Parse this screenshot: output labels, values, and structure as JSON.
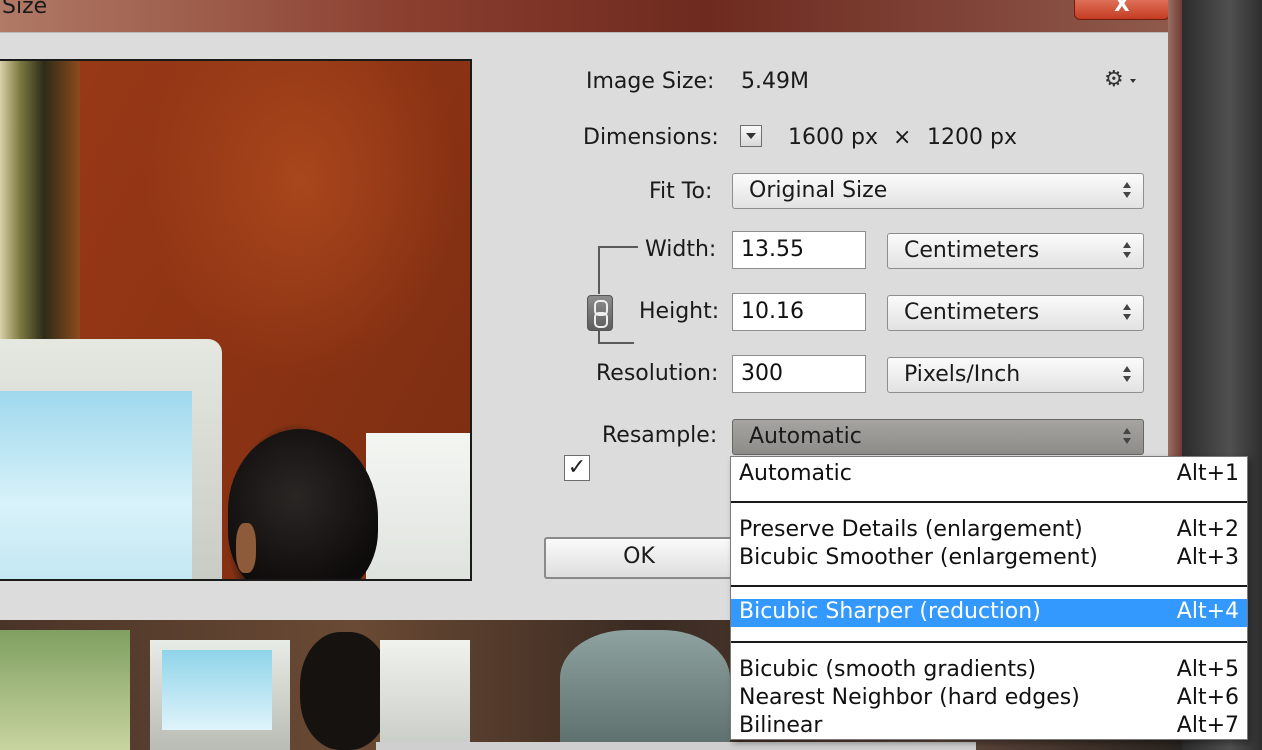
{
  "window": {
    "title": "Size",
    "close_label": "X"
  },
  "form": {
    "image_size_label": "Image Size:",
    "image_size_value": "5.49M",
    "dimensions_label": "Dimensions:",
    "dimensions_width": "1600 px",
    "dimensions_times": "×",
    "dimensions_height": "1200 px",
    "fit_to_label": "Fit To:",
    "fit_to_value": "Original Size",
    "width_label": "Width:",
    "width_value": "13.55",
    "width_unit": "Centimeters",
    "height_label": "Height:",
    "height_value": "10.16",
    "height_unit": "Centimeters",
    "resolution_label": "Resolution:",
    "resolution_value": "300",
    "resolution_unit": "Pixels/Inch",
    "resample_label": "Resample:",
    "resample_checked": true,
    "resample_check_glyph": "✓",
    "resample_value": "Automatic",
    "ok_label": "OK",
    "gear_glyph": "⚙"
  },
  "resample_menu": {
    "items": [
      {
        "label": "Automatic",
        "shortcut": "Alt+1"
      },
      {
        "label": "Preserve Details (enlargement)",
        "shortcut": "Alt+2"
      },
      {
        "label": "Bicubic Smoother (enlargement)",
        "shortcut": "Alt+3"
      },
      {
        "label": "Bicubic Sharper (reduction)",
        "shortcut": "Alt+4",
        "selected": true
      },
      {
        "label": "Bicubic (smooth gradients)",
        "shortcut": "Alt+5"
      },
      {
        "label": "Nearest Neighbor (hard edges)",
        "shortcut": "Alt+6"
      },
      {
        "label": "Bilinear",
        "shortcut": "Alt+7"
      }
    ]
  },
  "colors": {
    "menu_highlight": "#3399ff",
    "dialog_bg": "#dcdcdc",
    "close_button": "#c43c22"
  },
  "icons": {
    "gear": "gear-icon",
    "chain": "chain-link-icon",
    "select_arrows": "up-down-arrows-icon",
    "dimension_toggle": "triangle-down-icon"
  }
}
